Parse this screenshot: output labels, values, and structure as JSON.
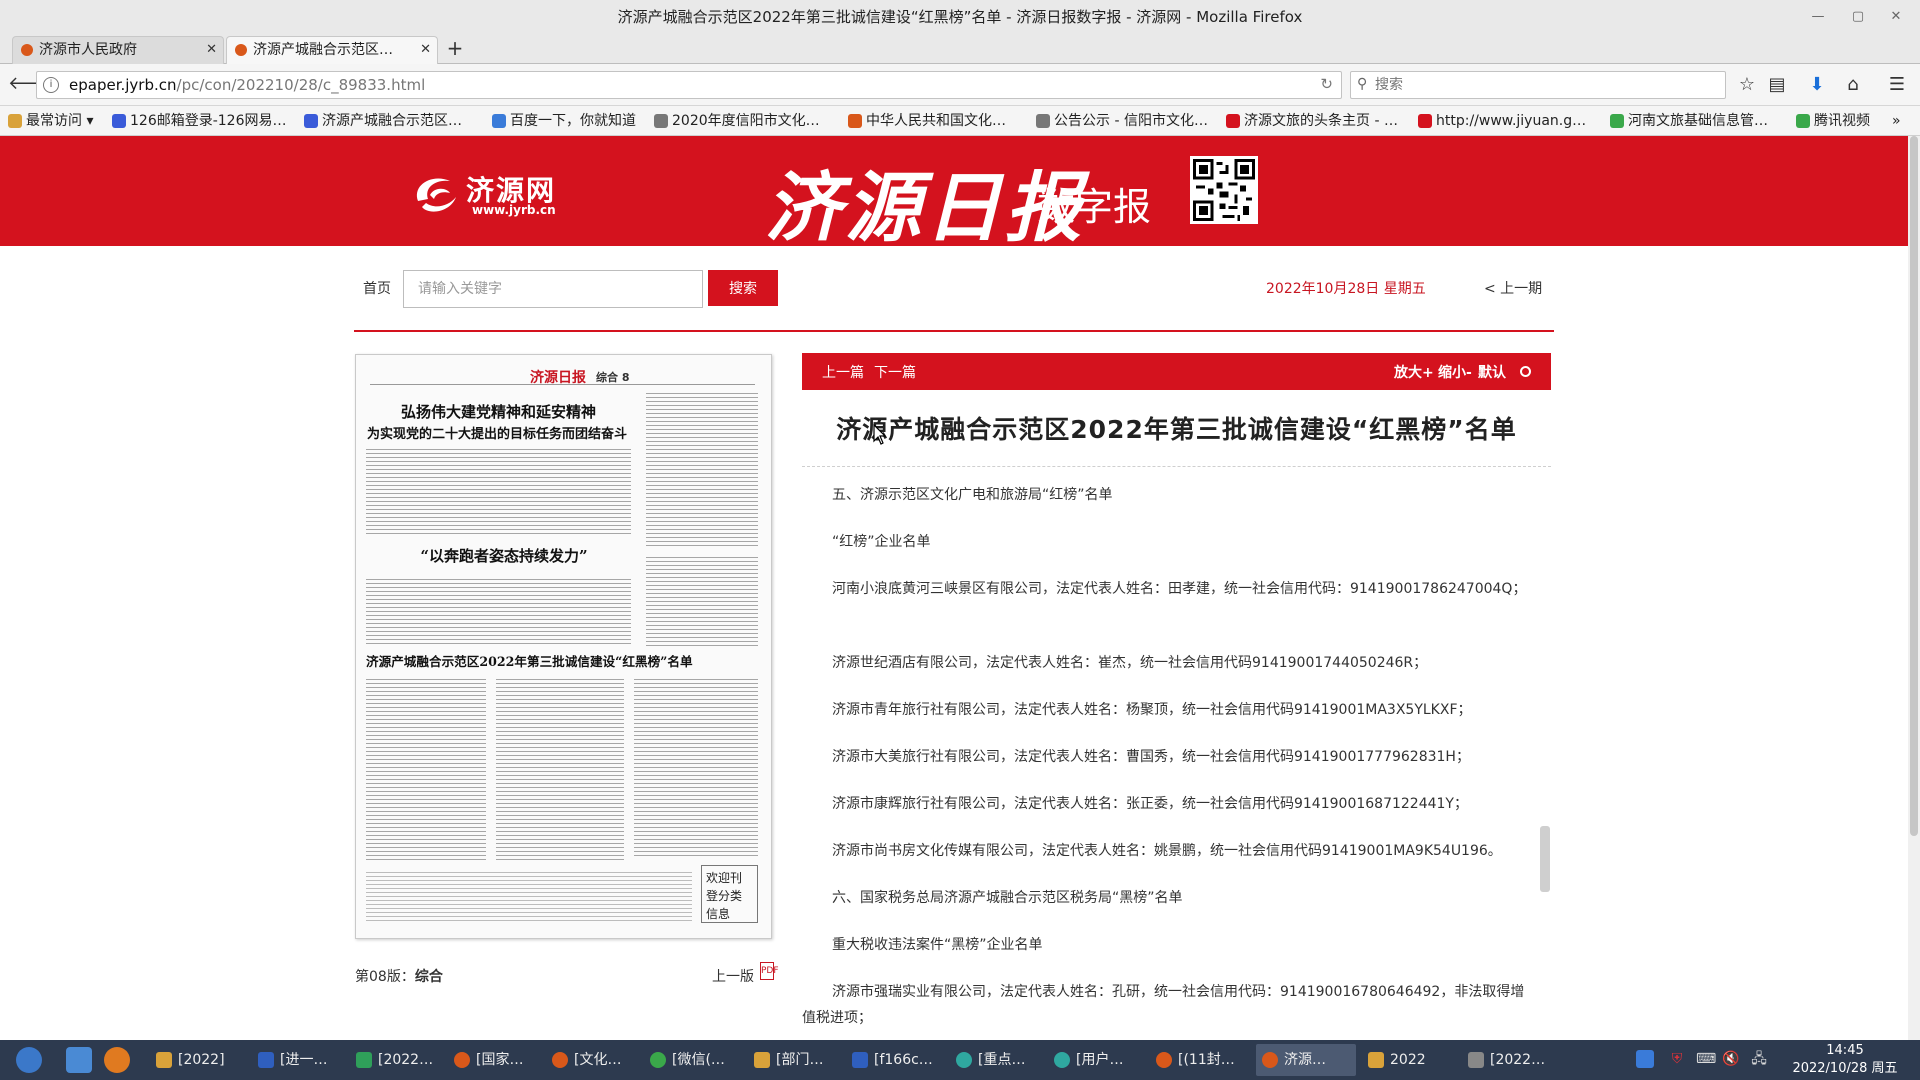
{
  "window": {
    "title": "济源产城融合示范区2022年第三批诚信建设“红黑榜”名单 - 济源日报数字报 - 济源网 - Mozilla Firefox"
  },
  "tabs": [
    {
      "label": "济源市人民政府",
      "active": false
    },
    {
      "label": "济源产城融合示范区…",
      "active": true
    }
  ],
  "nav": {
    "url_host": "epaper.jyrb.cn",
    "url_path": "/pc/con/202210/28/c_89833.html",
    "search_placeholder": "搜索"
  },
  "bookmarks": [
    {
      "label": "最常访问",
      "color": "#d9a23a"
    },
    {
      "label": "126邮箱登录-126网易…",
      "color": "#3a5bd9"
    },
    {
      "label": "济源产城融合示范区…",
      "color": "#3a5bd9"
    },
    {
      "label": "百度一下，你就知道",
      "color": "#3a7bd9"
    },
    {
      "label": "2020年度信阳市文化…",
      "color": "#777777"
    },
    {
      "label": "中华人民共和国文化…",
      "color": "#d9581a"
    },
    {
      "label": "公告公示 - 信阳市文化…",
      "color": "#777777"
    },
    {
      "label": "济源文旅的头条主页 - …",
      "color": "#d4121e"
    },
    {
      "label": "http://www.jiyuan.g…",
      "color": "#d4121e"
    },
    {
      "label": "河南文旅基础信息管…",
      "color": "#3aa84a"
    },
    {
      "label": "腾讯视频",
      "color": "#3aa84a"
    }
  ],
  "banner": {
    "site_name": "济源网",
    "site_url": "www.jyrb.cn",
    "paper_name": "济源日报",
    "digital": "数字报"
  },
  "toolbar": {
    "home": "首页",
    "keyword_placeholder": "请输入关键字",
    "search_label": "搜索",
    "date": "2022年10月28日  星期五",
    "prev_issue": "< 上一期"
  },
  "thumbnail": {
    "masthead_logo": "济源日报",
    "section": "综合 8",
    "headline1": "弘扬伟大建党精神和延安精神",
    "headline2": "为实现党的二十大提出的目标任务而团结奋斗",
    "headline3": "“以奔跑者姿态持续发力”",
    "headline4": "济源产城融合示范区2022年第三批诚信建设“红黑榜”名单",
    "footbox": "欢迎刊登分类信息"
  },
  "page_info": {
    "prefix": "第08版：",
    "name": "综合",
    "prev_page": "上一版"
  },
  "article": {
    "prev": "上一篇",
    "next": "下一篇",
    "zoom_in": "放大+",
    "zoom_out": "缩小-",
    "default": "默认",
    "title": "济源产城融合示范区2022年第三批诚信建设“红黑榜”名单",
    "paragraphs": [
      "五、济源示范区文化广电和旅游局“红榜”名单",
      "“红榜”企业名单",
      "河南小浪底黄河三峡景区有限公司，法定代表人姓名：田孝建，统一社会信用代码：91419001786247004Q；",
      "济源世纪酒店有限公司，法定代表人姓名：崔杰，统一社会信用代码91419001744050246R；",
      "济源市青年旅行社有限公司，法定代表人姓名：杨聚顶，统一社会信用代码91419001MA3X5YLKXF；",
      "济源市大美旅行社有限公司，法定代表人姓名：曹国秀，统一社会信用代码91419001777962831H；",
      "济源市康辉旅行社有限公司，法定代表人姓名：张正委，统一社会信用代码91419001687122441Y；",
      "济源市尚书房文化传媒有限公司，法定代表人姓名：姚景鹏，统一社会信用代码91419001MA9K54U196。",
      "六、国家税务总局济源产城融合示范区税务局“黑榜”名单",
      "重大税收违法案件“黑榜”企业名单",
      "济源市强瑞实业有限公司，法定代表人姓名：孔研，统一社会信用代码：914190016780646492，非法取得增值税进项；"
    ]
  },
  "taskbar": {
    "tasks": [
      {
        "label": "[2022]",
        "color": "#d9a23a"
      },
      {
        "label": "[进一…",
        "color": "#2f5fbf"
      },
      {
        "label": "[2022…",
        "color": "#2f9f5a"
      },
      {
        "label": "[国家…",
        "color": "#d9581a"
      },
      {
        "label": "[文化…",
        "color": "#d9581a"
      },
      {
        "label": "[微信(…",
        "color": "#3aa84a"
      },
      {
        "label": "[部门…",
        "color": "#d9a23a"
      },
      {
        "label": "[f166c…",
        "color": "#2f5fbf"
      },
      {
        "label": "[重点…",
        "color": "#2fa8a0"
      },
      {
        "label": "[用户…",
        "color": "#2fa8a0"
      },
      {
        "label": "[(11封…",
        "color": "#d9581a"
      },
      {
        "label": "济源…",
        "color": "#d9581a"
      },
      {
        "label": "2022",
        "color": "#d9a23a"
      },
      {
        "label": "[2022…",
        "color": "#888888"
      }
    ],
    "time": "14:45",
    "date": "2022/10/28 周五"
  }
}
